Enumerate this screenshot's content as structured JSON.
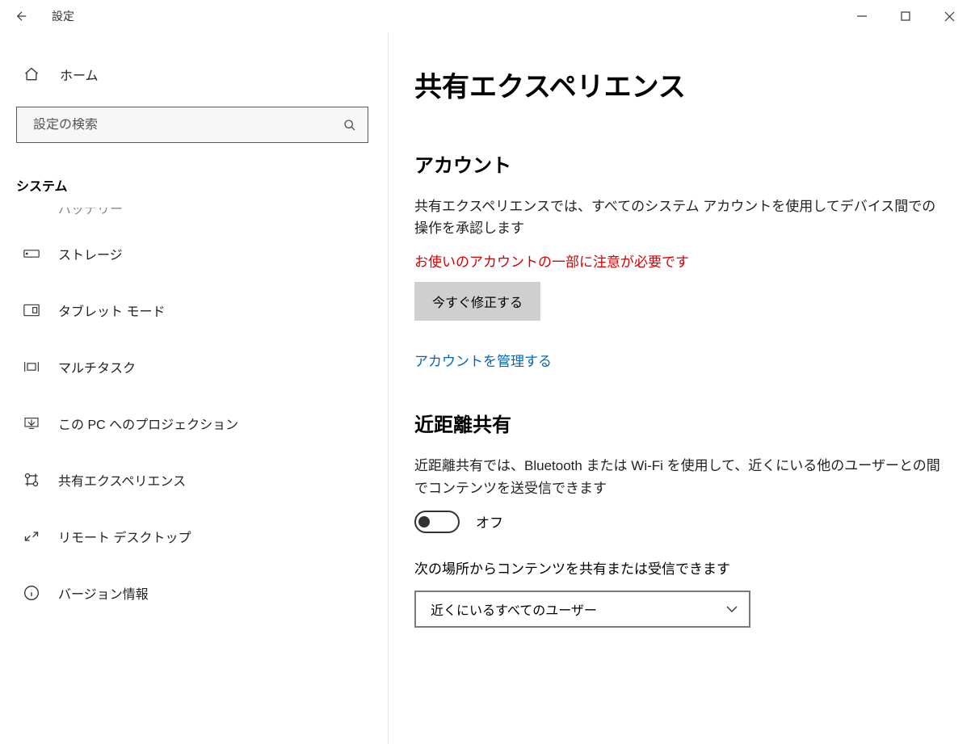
{
  "titlebar": {
    "title": "設定"
  },
  "sidebar": {
    "home": "ホーム",
    "search_placeholder": "設定の検索",
    "section": "システム",
    "items": [
      {
        "icon": "battery-icon",
        "label": "バッテリー"
      },
      {
        "icon": "storage-icon",
        "label": "ストレージ"
      },
      {
        "icon": "tablet-icon",
        "label": "タブレット モード"
      },
      {
        "icon": "multitask-icon",
        "label": "マルチタスク"
      },
      {
        "icon": "projection-icon",
        "label": "この PC へのプロジェクション"
      },
      {
        "icon": "shared-exp-icon",
        "label": "共有エクスペリエンス"
      },
      {
        "icon": "remote-icon",
        "label": "リモート デスクトップ"
      },
      {
        "icon": "about-icon",
        "label": "バージョン情報"
      }
    ]
  },
  "content": {
    "page_title": "共有エクスペリエンス",
    "account": {
      "title": "アカウント",
      "body": "共有エクスペリエンスでは、すべてのシステム アカウントを使用してデバイス間での操作を承認します",
      "warn": "お使いのアカウントの一部に注意が必要です",
      "fix_button": "今すぐ修正する",
      "manage_link": "アカウントを管理する"
    },
    "nearby": {
      "title": "近距離共有",
      "body": "近距離共有では、Bluetooth または Wi-Fi を使用して、近くにいる他のユーザーとの間でコンテンツを送受信できます",
      "toggle_state": "オフ",
      "share_from_label": "次の場所からコンテンツを共有または受信できます",
      "dropdown_selected": "近くにいるすべてのユーザー"
    }
  }
}
